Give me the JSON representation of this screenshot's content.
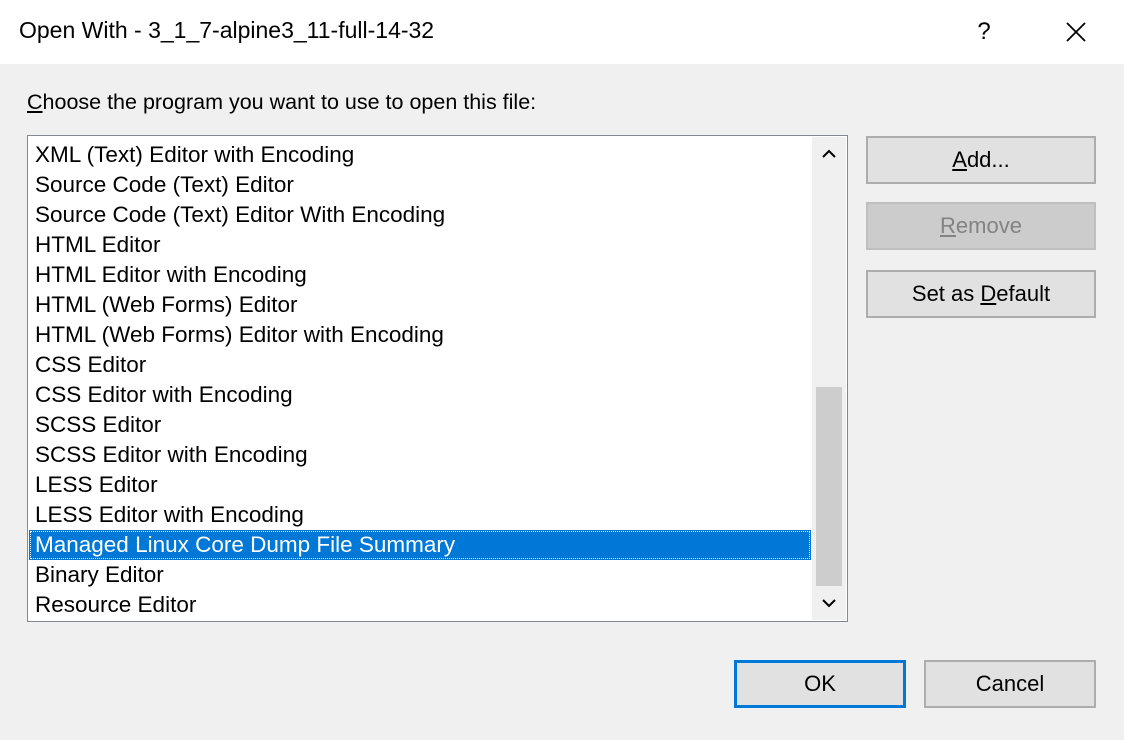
{
  "window": {
    "title": "Open With - 3_1_7-alpine3_11-full-14-32",
    "help_glyph": "?",
    "close_icon": "close-icon"
  },
  "prompt": {
    "accel": "C",
    "rest": "hoose the program you want to use to open this file:"
  },
  "programs": {
    "items": [
      "XML (Text) Editor with Encoding",
      "Source Code (Text) Editor",
      "Source Code (Text) Editor With Encoding",
      "HTML Editor",
      "HTML Editor with Encoding",
      "HTML (Web Forms) Editor",
      "HTML (Web Forms) Editor with Encoding",
      "CSS Editor",
      "CSS Editor with Encoding",
      "SCSS Editor",
      "SCSS Editor with Encoding",
      "LESS Editor",
      "LESS Editor with Encoding",
      "Managed Linux Core Dump File Summary",
      "Binary Editor",
      "Resource Editor"
    ],
    "selected_index": 13,
    "scroll_thumb_start": 0.52,
    "scroll_thumb_end": 1.0
  },
  "buttons": {
    "add": {
      "accel": "A",
      "rest": "dd..."
    },
    "remove": {
      "accel": "R",
      "rest": "emove"
    },
    "set_default": {
      "pre": "Set as ",
      "accel": "D",
      "rest": "efault"
    },
    "ok": "OK",
    "cancel": "Cancel"
  },
  "colors": {
    "selection": "#0078d7",
    "default_button_border": "#0078d7"
  }
}
